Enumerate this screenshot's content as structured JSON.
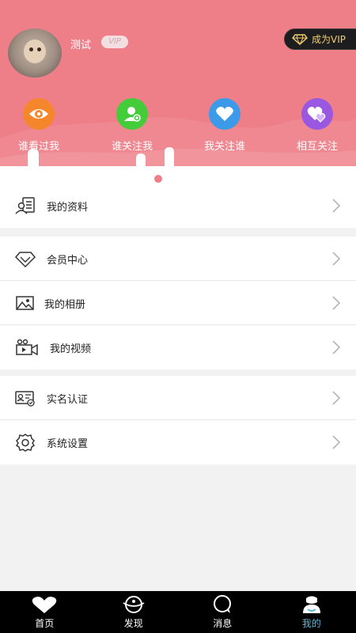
{
  "profile": {
    "username": "测试",
    "vip_badge": "VIP",
    "become_vip_label": "成为VIP"
  },
  "quick_actions": [
    {
      "label": "谁看过我",
      "icon": "eye-icon",
      "color": "#f5862b"
    },
    {
      "label": "谁关注我",
      "icon": "user-follow-icon",
      "color": "#45cc3a"
    },
    {
      "label": "我关注谁",
      "icon": "heart-icon",
      "color": "#3d9ae8"
    },
    {
      "label": "相互关注",
      "icon": "double-heart-icon",
      "color": "#9a58e0"
    }
  ],
  "menu": {
    "profile": "我的资料",
    "member_center": "会员中心",
    "album": "我的相册",
    "video": "我的视频",
    "verification": "实名认证",
    "settings": "系统设置"
  },
  "tabs": [
    {
      "label": "首页",
      "icon": "home-icon"
    },
    {
      "label": "发现",
      "icon": "discover-icon"
    },
    {
      "label": "消息",
      "icon": "message-icon"
    },
    {
      "label": "我的",
      "icon": "profile-icon",
      "active": true
    }
  ],
  "colors": {
    "header": "#ee7f89",
    "vip_gold": "#f2cf6b",
    "tab_active": "#5fb8d8"
  }
}
